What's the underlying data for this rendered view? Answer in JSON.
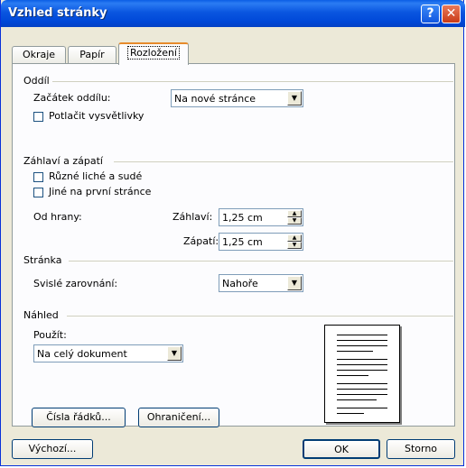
{
  "window": {
    "title": "Vzhled stránky",
    "help_icon": "?",
    "close_icon": "✕"
  },
  "tabs": [
    {
      "label": "Okraje"
    },
    {
      "label": "Papír"
    },
    {
      "label": "Rozložení",
      "active": true
    }
  ],
  "section_oddil": {
    "title": "Oddíl",
    "start_label": "Začátek oddílu:",
    "start_value": "Na nové stránce",
    "suppress_label": "Potlačit vysvětlivky",
    "suppress_checked": false
  },
  "section_header": {
    "title": "Záhlaví a zápatí",
    "odd_even_label": "Různé liché a sudé",
    "first_page_label": "Jiné na první stránce",
    "from_edge_label": "Od hrany:",
    "header_label": "Záhlaví:",
    "header_value": "1,25 cm",
    "footer_label": "Zápatí:",
    "footer_value": "1,25 cm"
  },
  "section_page": {
    "title": "Stránka",
    "valign_label": "Svislé zarovnání:",
    "valign_value": "Nahoře"
  },
  "section_preview": {
    "title": "Náhled",
    "apply_label": "Použít:",
    "apply_value": "Na celý dokument"
  },
  "buttons": {
    "line_numbers": "Čísla řádků...",
    "borders": "Ohraničení...",
    "default": "Výchozí...",
    "ok": "OK",
    "cancel": "Storno"
  }
}
